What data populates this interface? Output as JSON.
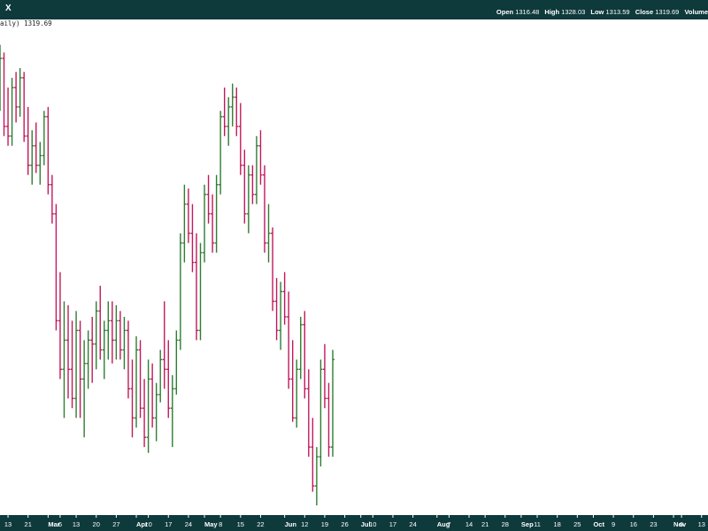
{
  "header": {
    "ticker": "X",
    "period_label": "aily)",
    "last_close": "1319.69",
    "open_label": "Open",
    "open": "1316.48",
    "high_label": "High",
    "high": "1328.03",
    "low_label": "Low",
    "low": "1313.59",
    "close_label": "Close",
    "close": "1319.69",
    "volume_label": "Volume"
  },
  "colors": {
    "up": "#2e7d32",
    "down": "#c2185b",
    "frame": "#0e3a3c"
  },
  "chart_data": {
    "type": "ohlc",
    "title": "",
    "x_ticks": [
      {
        "day": 2,
        "label": "13"
      },
      {
        "day": 7,
        "label": "21"
      },
      {
        "day": 12,
        "label": "Mar",
        "major": true
      },
      {
        "day": 15,
        "label": "6"
      },
      {
        "day": 19,
        "label": "13"
      },
      {
        "day": 24,
        "label": "20"
      },
      {
        "day": 29,
        "label": "27"
      },
      {
        "day": 34,
        "label": "Apr",
        "major": true
      },
      {
        "day": 37,
        "label": "10"
      },
      {
        "day": 42,
        "label": "17"
      },
      {
        "day": 47,
        "label": "24"
      },
      {
        "day": 51,
        "label": "May",
        "major": true
      },
      {
        "day": 55,
        "label": "8"
      },
      {
        "day": 60,
        "label": "15"
      },
      {
        "day": 65,
        "label": "22"
      },
      {
        "day": 71,
        "label": "Jun",
        "major": true
      },
      {
        "day": 76,
        "label": "12"
      },
      {
        "day": 81,
        "label": "19"
      },
      {
        "day": 86,
        "label": "26"
      },
      {
        "day": 90,
        "label": "Jul",
        "major": true
      },
      {
        "day": 93,
        "label": "10"
      },
      {
        "day": 98,
        "label": "17"
      },
      {
        "day": 103,
        "label": "24"
      },
      {
        "day": 109,
        "label": "Aug",
        "major": true
      },
      {
        "day": 112,
        "label": "7"
      },
      {
        "day": 117,
        "label": "14"
      },
      {
        "day": 121,
        "label": "21"
      },
      {
        "day": 126,
        "label": "28"
      },
      {
        "day": 130,
        "label": "Sep",
        "major": true
      },
      {
        "day": 134,
        "label": "11"
      },
      {
        "day": 139,
        "label": "18"
      },
      {
        "day": 144,
        "label": "25"
      },
      {
        "day": 148,
        "label": "Oct",
        "major": true
      },
      {
        "day": 153,
        "label": "9"
      },
      {
        "day": 158,
        "label": "16"
      },
      {
        "day": 163,
        "label": "23"
      },
      {
        "day": 168,
        "label": "Nov",
        "major": true
      },
      {
        "day": 170,
        "label": "6"
      },
      {
        "day": 175,
        "label": "13"
      }
    ],
    "price_range": [
      1250,
      1500
    ],
    "bars": [
      [
        1480,
        1492,
        1458,
        1485
      ],
      [
        1485,
        1488,
        1445,
        1450
      ],
      [
        1450,
        1470,
        1440,
        1445
      ],
      [
        1445,
        1475,
        1440,
        1470
      ],
      [
        1470,
        1478,
        1452,
        1460
      ],
      [
        1460,
        1480,
        1455,
        1475
      ],
      [
        1475,
        1478,
        1442,
        1445
      ],
      [
        1445,
        1460,
        1425,
        1430
      ],
      [
        1430,
        1448,
        1420,
        1440
      ],
      [
        1440,
        1452,
        1426,
        1430
      ],
      [
        1430,
        1442,
        1420,
        1435
      ],
      [
        1435,
        1458,
        1430,
        1455
      ],
      [
        1455,
        1460,
        1415,
        1420
      ],
      [
        1420,
        1425,
        1400,
        1405
      ],
      [
        1405,
        1410,
        1345,
        1350
      ],
      [
        1350,
        1375,
        1320,
        1325
      ],
      [
        1325,
        1360,
        1300,
        1340
      ],
      [
        1340,
        1358,
        1310,
        1325
      ],
      [
        1325,
        1350,
        1305,
        1310
      ],
      [
        1310,
        1355,
        1300,
        1345
      ],
      [
        1345,
        1350,
        1300,
        1320
      ],
      [
        1320,
        1340,
        1290,
        1328
      ],
      [
        1328,
        1345,
        1315,
        1340
      ],
      [
        1340,
        1352,
        1318,
        1338
      ],
      [
        1338,
        1360,
        1325,
        1355
      ],
      [
        1355,
        1368,
        1330,
        1335
      ],
      [
        1335,
        1350,
        1320,
        1345
      ],
      [
        1345,
        1360,
        1330,
        1350
      ],
      [
        1350,
        1360,
        1328,
        1340
      ],
      [
        1340,
        1358,
        1330,
        1350
      ],
      [
        1350,
        1355,
        1330,
        1335
      ],
      [
        1335,
        1352,
        1325,
        1345
      ],
      [
        1345,
        1350,
        1310,
        1315
      ],
      [
        1315,
        1330,
        1290,
        1300
      ],
      [
        1300,
        1342,
        1295,
        1335
      ],
      [
        1335,
        1340,
        1300,
        1305
      ],
      [
        1305,
        1320,
        1285,
        1290
      ],
      [
        1290,
        1330,
        1282,
        1320
      ],
      [
        1320,
        1328,
        1295,
        1300
      ],
      [
        1300,
        1318,
        1288,
        1312
      ],
      [
        1312,
        1335,
        1308,
        1330
      ],
      [
        1330,
        1360,
        1315,
        1325
      ],
      [
        1325,
        1340,
        1300,
        1305
      ],
      [
        1305,
        1322,
        1285,
        1315
      ],
      [
        1315,
        1345,
        1312,
        1340
      ],
      [
        1340,
        1395,
        1335,
        1390
      ],
      [
        1390,
        1420,
        1380,
        1410
      ],
      [
        1410,
        1418,
        1390,
        1395
      ],
      [
        1395,
        1410,
        1375,
        1380
      ],
      [
        1380,
        1395,
        1340,
        1345
      ],
      [
        1345,
        1390,
        1340,
        1385
      ],
      [
        1385,
        1420,
        1380,
        1415
      ],
      [
        1415,
        1425,
        1400,
        1405
      ],
      [
        1405,
        1415,
        1385,
        1390
      ],
      [
        1390,
        1425,
        1385,
        1420
      ],
      [
        1420,
        1458,
        1415,
        1455
      ],
      [
        1455,
        1470,
        1445,
        1450
      ],
      [
        1450,
        1465,
        1440,
        1460
      ],
      [
        1460,
        1472,
        1450,
        1465
      ],
      [
        1465,
        1470,
        1445,
        1450
      ],
      [
        1450,
        1462,
        1425,
        1430
      ],
      [
        1430,
        1438,
        1400,
        1405
      ],
      [
        1405,
        1430,
        1395,
        1425
      ],
      [
        1425,
        1430,
        1410,
        1415
      ],
      [
        1415,
        1445,
        1410,
        1440
      ],
      [
        1440,
        1448,
        1420,
        1425
      ],
      [
        1425,
        1430,
        1385,
        1390
      ],
      [
        1390,
        1410,
        1380,
        1395
      ],
      [
        1395,
        1398,
        1355,
        1360
      ],
      [
        1360,
        1372,
        1340,
        1345
      ],
      [
        1345,
        1370,
        1335,
        1365
      ],
      [
        1365,
        1375,
        1348,
        1352
      ],
      [
        1352,
        1365,
        1315,
        1320
      ],
      [
        1320,
        1340,
        1298,
        1300
      ],
      [
        1300,
        1330,
        1295,
        1325
      ],
      [
        1325,
        1352,
        1320,
        1348
      ],
      [
        1348,
        1355,
        1310,
        1315
      ],
      [
        1315,
        1325,
        1280,
        1285
      ],
      [
        1285,
        1300,
        1262,
        1265
      ],
      [
        1265,
        1285,
        1255,
        1280
      ],
      [
        1280,
        1330,
        1275,
        1325
      ],
      [
        1325,
        1338,
        1305,
        1310
      ],
      [
        1310,
        1318,
        1280,
        1285
      ],
      [
        1285,
        1335,
        1280,
        1330
      ]
    ]
  }
}
